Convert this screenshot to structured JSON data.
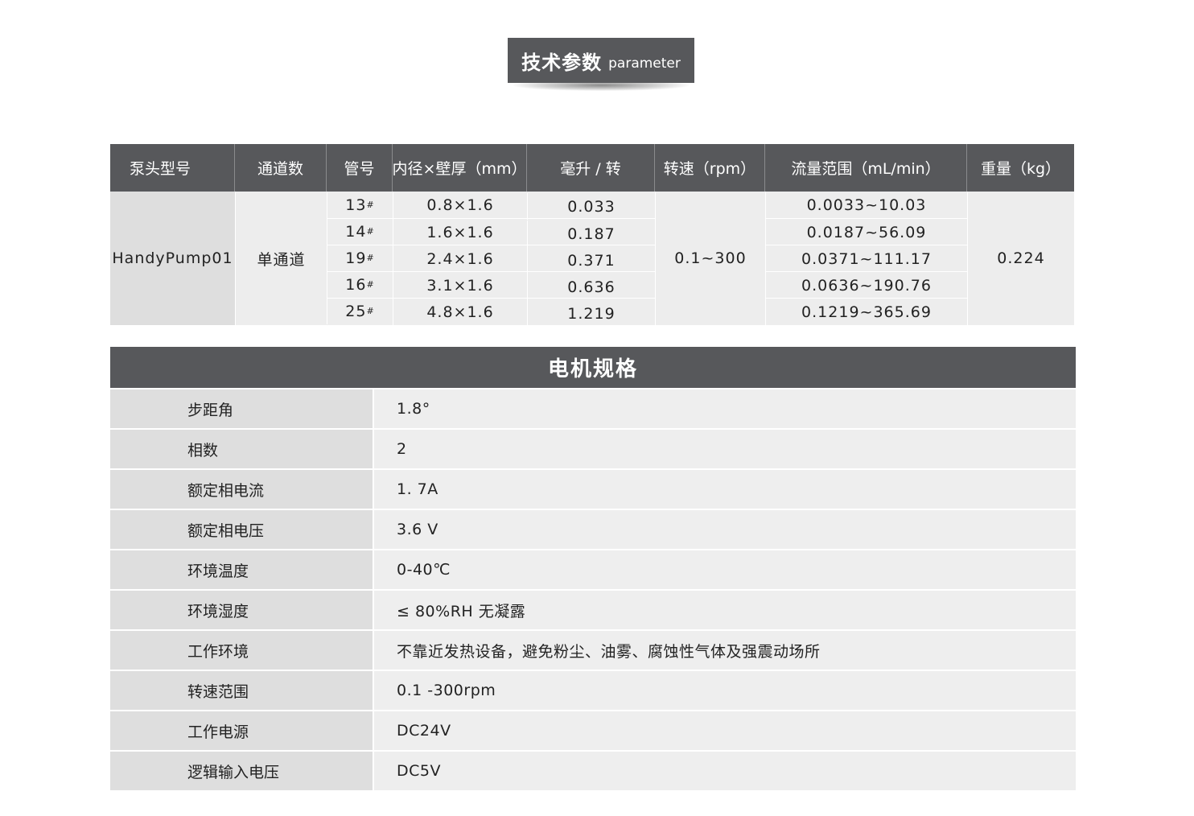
{
  "header": {
    "title": "技术参数",
    "subtitle": "parameter"
  },
  "spec_table": {
    "columns": [
      "泵头型号",
      "通道数",
      "管号",
      "内径×壁厚（mm）",
      "毫升 / 转",
      "转速（rpm）",
      "流量范围（mL/min）",
      "重量（kg）"
    ],
    "model": "HandyPump01",
    "channels": "单通道",
    "speed": "0.1~300",
    "weight": "0.224",
    "rows": [
      {
        "tube": "13",
        "mark": "#",
        "dims": "0.8×1.6",
        "ml_per_rev": "0.033",
        "flow": "0.0033~10.03"
      },
      {
        "tube": "14",
        "mark": "#",
        "dims": "1.6×1.6",
        "ml_per_rev": "0.187",
        "flow": "0.0187~56.09"
      },
      {
        "tube": "19",
        "mark": "#",
        "dims": "2.4×1.6",
        "ml_per_rev": "0.371",
        "flow": "0.0371~111.17"
      },
      {
        "tube": "16",
        "mark": "#",
        "dims": "3.1×1.6",
        "ml_per_rev": "0.636",
        "flow": "0.0636~190.76"
      },
      {
        "tube": "25",
        "mark": "#",
        "dims": "4.8×1.6",
        "ml_per_rev": "1.219",
        "flow": "0.1219~365.69"
      }
    ]
  },
  "motor": {
    "title": "电机规格",
    "rows": [
      {
        "label": "步距角",
        "value": "1.8°"
      },
      {
        "label": "相数",
        "value": "2"
      },
      {
        "label": "额定相电流",
        "value": "1. 7A"
      },
      {
        "label": "额定相电压",
        "value": "3.6 V"
      },
      {
        "label": "环境温度",
        "value": "0-40℃"
      },
      {
        "label": "环境湿度",
        "value": " ≤ 80%RH 无凝露"
      },
      {
        "label": "工作环境",
        "value": "不靠近发热设备，避免粉尘、油雾、腐蚀性气体及强震动场所"
      },
      {
        "label": "转速范围",
        "value": "0.1 -300rpm"
      },
      {
        "label": "工作电源",
        "value": "DC24V"
      },
      {
        "label": "逻辑输入电压",
        "value": " DC5V"
      }
    ]
  }
}
